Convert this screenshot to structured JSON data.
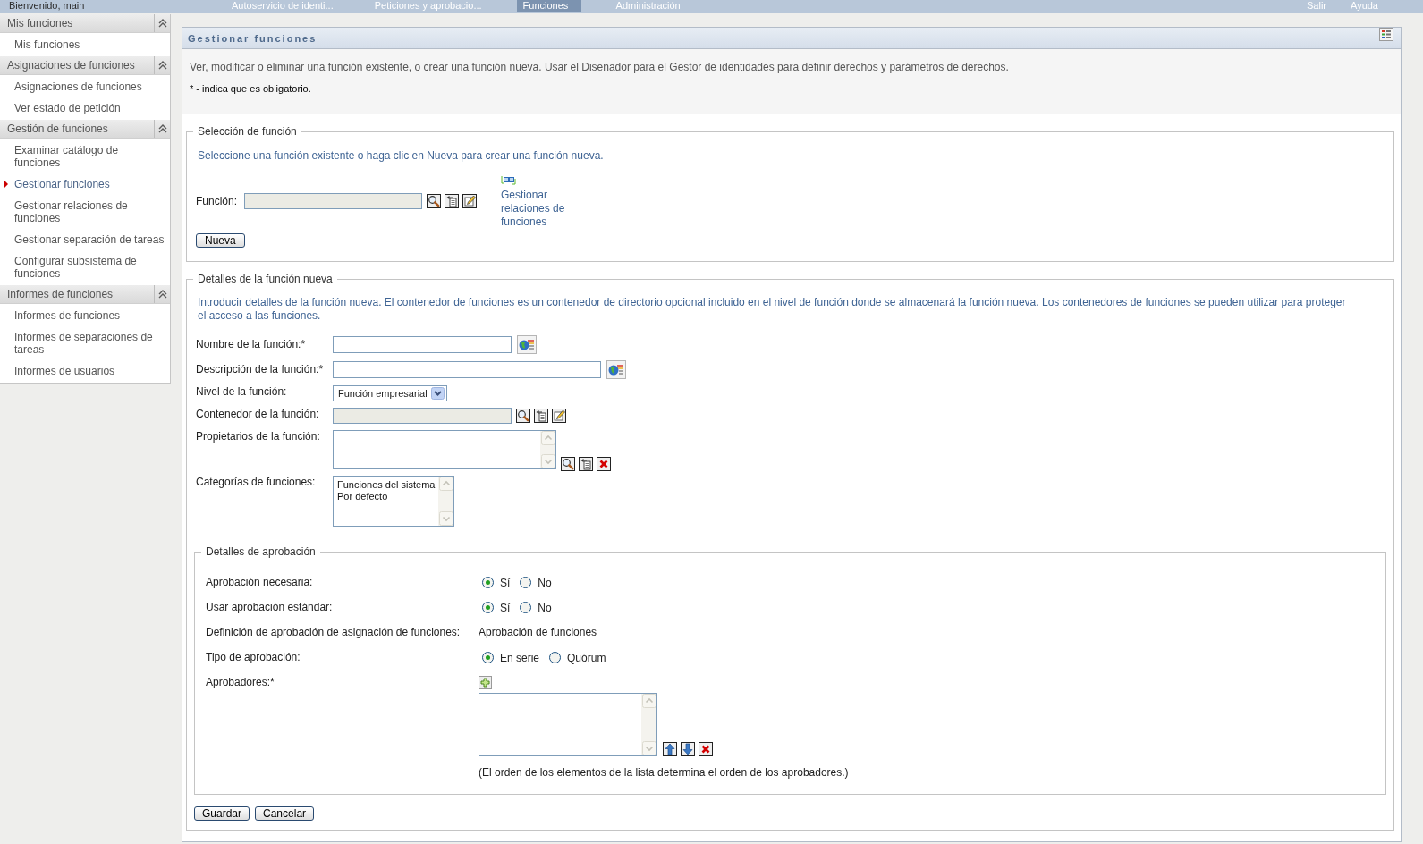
{
  "top_bar": {
    "welcome": "Bienvenido, main",
    "tabs": [
      {
        "label": "Autoservicio de identi...",
        "selected": false
      },
      {
        "label": "Peticiones y aprobacio...",
        "selected": false
      },
      {
        "label": "Funciones",
        "selected": true
      },
      {
        "label": "Administración",
        "selected": false
      }
    ],
    "links": [
      "Salir",
      "Ayuda"
    ]
  },
  "sidebar": {
    "sections": [
      {
        "title": "Mis funciones",
        "expanded": true,
        "items": [
          {
            "label": "Mis funciones",
            "selected": false
          }
        ]
      },
      {
        "title": "Asignaciones de funciones",
        "expanded": true,
        "items": [
          {
            "label": "Asignaciones de funciones",
            "selected": false
          },
          {
            "label": "Ver estado de petición",
            "selected": false
          }
        ]
      },
      {
        "title": "Gestión de funciones",
        "expanded": true,
        "items": [
          {
            "label": "Examinar catálogo de funciones",
            "selected": false
          },
          {
            "label": "Gestionar funciones",
            "selected": true
          },
          {
            "label": "Gestionar relaciones de funciones",
            "selected": false
          },
          {
            "label": "Gestionar separación de tareas",
            "selected": false
          },
          {
            "label": "Configurar subsistema de funciones",
            "selected": false
          }
        ]
      },
      {
        "title": "Informes de funciones",
        "expanded": true,
        "items": [
          {
            "label": "Informes de funciones",
            "selected": false
          },
          {
            "label": "Informes de separaciones de tareas",
            "selected": false
          },
          {
            "label": "Informes de usuarios",
            "selected": false
          }
        ]
      }
    ]
  },
  "panel": {
    "title": "Gestionar funciones",
    "description": "Ver, modificar o eliminar una función existente, o crear una función nueva. Usar el Diseñador para el Gestor de identidades para definir derechos y parámetros de derechos.",
    "required_note": "* - indica que es obligatorio."
  },
  "role_selection": {
    "legend": "Selección de función",
    "instructions": "Seleccione una función existente o haga clic en Nueva para crear una función nueva.",
    "field": {
      "label": "Función:",
      "disabled": true
    },
    "related_link": "Gestionar relaciones de funciones",
    "new_button": "Nueva"
  },
  "new_role": {
    "legend": "Detalles de la función nueva",
    "instructions": "Introducir detalles de la función nueva. El contenedor de funciones es un contenedor de directorio opcional incluido en el nivel de función donde se almacenará la función nueva. Los contenedores de funciones se pueden utilizar para proteger el acceso a las funciones.",
    "fields": [
      {
        "kind": "text",
        "label": "Nombre de la función:*",
        "disabled": false
      },
      {
        "kind": "text",
        "label": "Descripción de la función:*",
        "disabled": false
      },
      {
        "kind": "select",
        "label": "Nivel de la función:",
        "value": "Función empresarial",
        "disabled": false
      },
      {
        "kind": "picker",
        "label": "Contenedor de la función:",
        "disabled": true
      },
      {
        "kind": "multi_picker",
        "label": "Propietarios de la función:",
        "disabled": false
      },
      {
        "kind": "list",
        "label": "Categorías de funciones:",
        "disabled": false,
        "options": [
          {
            "label": "Funciones del sistema",
            "selected": false
          },
          {
            "label": "Por defecto",
            "selected": false
          }
        ]
      }
    ]
  },
  "approval": {
    "legend": "Detalles de aprobación",
    "rows": [
      {
        "kind": "radio",
        "label": "Aprobación necesaria:",
        "options": [
          {
            "label": "Sí",
            "selected": true
          },
          {
            "label": "No",
            "selected": false
          }
        ]
      },
      {
        "kind": "radio",
        "label": "Usar aprobación estándar:",
        "options": [
          {
            "label": "Sí",
            "selected": true
          },
          {
            "label": "No",
            "selected": false
          }
        ]
      },
      {
        "kind": "value",
        "label": "Definición de aprobación de asignación de funciones:",
        "value": "Aprobación de funciones"
      },
      {
        "kind": "radio",
        "label": "Tipo de aprobación:",
        "options": [
          {
            "label": "En serie",
            "selected": true
          },
          {
            "label": "Quórum",
            "selected": false
          }
        ]
      },
      {
        "kind": "approvers",
        "label": "Aprobadores:*",
        "note": "(El orden de los elementos de la lista determina el orden de los aprobadores.)"
      }
    ]
  },
  "buttons": [
    "Guardar",
    "Cancelar"
  ]
}
